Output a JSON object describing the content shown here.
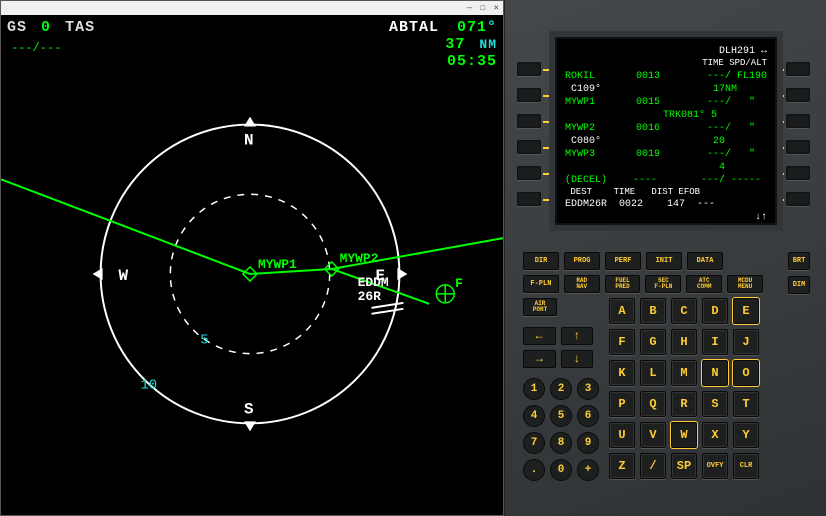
{
  "nd": {
    "gs_label": "GS",
    "gs_value": "0",
    "tas_label": "TAS",
    "dash": "---/---",
    "wpt": "ABTAL",
    "brg": "071",
    "deg": "°",
    "dist": "37",
    "nm": "NM",
    "time": "05:35",
    "compass": {
      "n": "N",
      "e": "E",
      "s": "S",
      "w": "W"
    },
    "range_inner": "5",
    "range_outer": "10",
    "waypoints": {
      "w1": "MYWP1",
      "w2": "MYWP2"
    },
    "airport": {
      "l1": "EDDM",
      "l2": "26R"
    },
    "f_symbol": "F"
  },
  "mcdu": {
    "title_right": "DLH291",
    "hdr": "TIME SPD/ALT",
    "rows": [
      {
        "l": "ROKIL",
        "lc": "g",
        "t": "0013",
        "r": "---/ FL190"
      },
      {
        "l": " C109°",
        "lc": "w",
        "t": "",
        "r": "  17NM     "
      },
      {
        "l": "MYWP1",
        "lc": "g",
        "t": "0015",
        "r": "---/   \"  "
      },
      {
        "l": "",
        "lc": "w",
        "t": "TRK081° 5",
        "r": ""
      },
      {
        "l": "MYWP2",
        "lc": "g",
        "t": "0016",
        "r": "---/   \"  "
      },
      {
        "l": " C080°",
        "lc": "w",
        "t": "",
        "r": "  20       "
      },
      {
        "l": "MYWP3",
        "lc": "g",
        "t": "0019",
        "r": "---/   \"  "
      },
      {
        "l": "",
        "lc": "w",
        "t": "",
        "r": "   4       "
      },
      {
        "l": "(DECEL)",
        "lc": "g",
        "t": "----",
        "r": "---/ ----- "
      }
    ],
    "dest_hdr": " DEST    TIME   DIST EFOB",
    "dest_row": "EDDM26R  0022    147  ---",
    "arrows": "↓↑"
  },
  "keys": {
    "fn1": [
      "DIR",
      "PROG",
      "PERF",
      "INIT",
      "DATA"
    ],
    "fn2": [
      "F-PLN",
      "RAD\nNAV",
      "FUEL\nPRED",
      "SEC\nF-PLN",
      "ATC\nCOMM",
      "MCDU\nMENU"
    ],
    "fn3": [
      "AIR\nPORT"
    ],
    "side": [
      "BRT",
      "DIM"
    ],
    "alpha": [
      "A",
      "B",
      "C",
      "D",
      "E",
      "F",
      "G",
      "H",
      "I",
      "J",
      "K",
      "L",
      "M",
      "N",
      "O",
      "P",
      "Q",
      "R",
      "S",
      "T",
      "U",
      "V",
      "W",
      "X",
      "Y",
      "Z",
      "/",
      "SP",
      "OVFY",
      "CLR"
    ],
    "boxed": [
      "E",
      "N",
      "O",
      "W"
    ],
    "num": [
      "1",
      "2",
      "3",
      "4",
      "5",
      "6",
      "7",
      "8",
      "9",
      ".",
      "0",
      "+"
    ],
    "numextra": [
      "-",
      "+"
    ]
  }
}
